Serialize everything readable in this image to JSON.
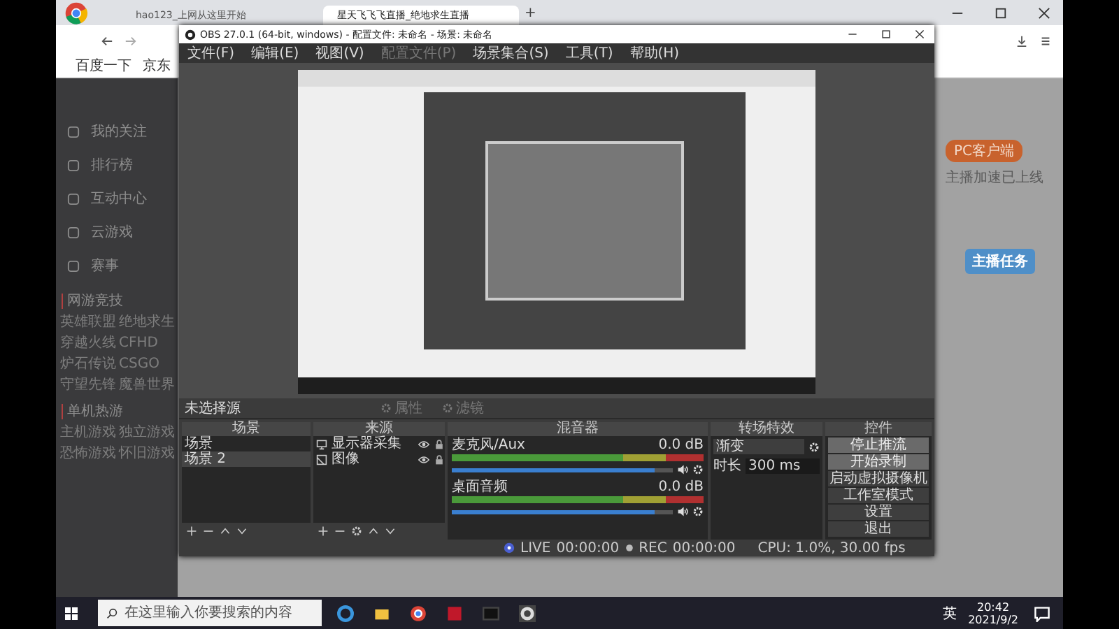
{
  "browser": {
    "tabs": [
      {
        "title": "hao123_上网从这里开始",
        "selected": false
      },
      {
        "title": "星天飞飞飞直播_绝地求生直播",
        "selected": true
      }
    ],
    "new_tab": "+",
    "bookmarks": [
      "百度一下",
      "京东"
    ]
  },
  "site": {
    "nav": [
      "我的关注",
      "排行榜",
      "互动中心",
      "云游戏",
      "赛事"
    ],
    "sections": [
      {
        "heading": "网游竞技",
        "items": [
          "英雄联盟",
          "绝地求生",
          "穿越火线",
          "CFHD",
          "炉石传说",
          "CSGO",
          "守望先锋",
          "魔兽世界"
        ]
      },
      {
        "heading": "单机热游",
        "items": [
          "主机游戏",
          "独立游戏",
          "恐怖游戏",
          "怀旧游戏"
        ]
      }
    ],
    "client_button": "PC客户端",
    "client_note": "主播加速已上线",
    "task_badge": "主播任务"
  },
  "obs": {
    "title": "OBS 27.0.1 (64-bit, windows) - 配置文件: 未命名 - 场景: 未命名",
    "menu": [
      {
        "label": "文件(F)",
        "disabled": false
      },
      {
        "label": "编辑(E)",
        "disabled": false
      },
      {
        "label": "视图(V)",
        "disabled": false
      },
      {
        "label": "配置文件(P)",
        "disabled": true
      },
      {
        "label": "场景集合(S)",
        "disabled": false
      },
      {
        "label": "工具(T)",
        "disabled": false
      },
      {
        "label": "帮助(H)",
        "disabled": false
      }
    ],
    "toolbar": {
      "source_label": "未选择源",
      "buttons": [
        {
          "label": "属性",
          "disabled": true
        },
        {
          "label": "滤镜",
          "disabled": true
        }
      ]
    },
    "scenes": {
      "title": "场景",
      "items": [
        {
          "label": "场景",
          "selected": false
        },
        {
          "label": "场景 2",
          "selected": true
        }
      ]
    },
    "sources": {
      "title": "来源",
      "items": [
        {
          "label": "显示器采集",
          "kind": "monitor"
        },
        {
          "label": "图像",
          "kind": "image"
        }
      ]
    },
    "mixer": {
      "title": "混音器",
      "channels": [
        {
          "name": "麦克风/Aux",
          "reading": "0.0 dB",
          "level": 0.92
        },
        {
          "name": "桌面音频",
          "reading": "0.0 dB",
          "level": 0.92
        }
      ]
    },
    "transitions": {
      "title": "转场特效",
      "type": "渐变",
      "duration_label": "时长",
      "duration": "300 ms"
    },
    "controls": {
      "title": "控件",
      "buttons": [
        {
          "label": "停止推流",
          "highlighted": true
        },
        {
          "label": "开始录制",
          "highlighted": true
        },
        {
          "label": "启动虚拟摄像机",
          "highlighted": false
        },
        {
          "label": "工作室模式",
          "highlighted": false
        },
        {
          "label": "设置",
          "highlighted": false
        },
        {
          "label": "退出",
          "highlighted": false
        }
      ]
    },
    "status": {
      "live": "LIVE",
      "live_time": "00:00:00",
      "rec": "REC",
      "rec_time": "00:00:00",
      "cpu": "CPU: 1.0%, 30.00 fps"
    }
  },
  "taskbar": {
    "search_placeholder": "在这里输入你要搜索的内容",
    "ime": "英",
    "time": "20:42",
    "date": "2021/9/2"
  }
}
